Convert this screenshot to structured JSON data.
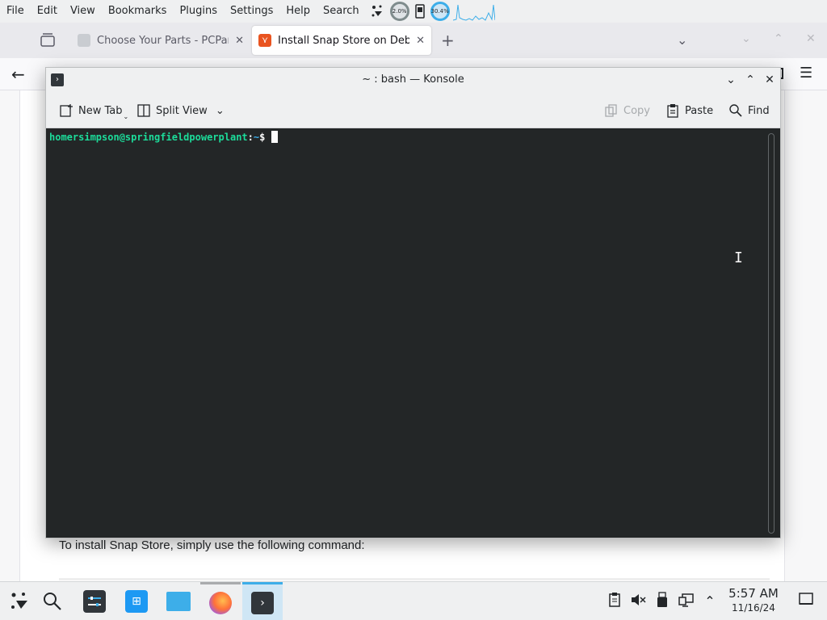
{
  "menubar": {
    "items": [
      "File",
      "Edit",
      "View",
      "Bookmarks",
      "Plugins",
      "Settings",
      "Help",
      "Search"
    ],
    "cpu_gauge": "2.0%",
    "net_gauge": "30.4%"
  },
  "browser": {
    "tabs": [
      {
        "title": "Choose Your Parts - PCPart",
        "icon": "pcpartpicker-favicon"
      },
      {
        "title": "Install Snap Store on Debia",
        "icon": "ubuntu-favicon",
        "active": true
      }
    ],
    "page_text": "To install Snap Store, simply use the following command:"
  },
  "konsole": {
    "title": "~ : bash — Konsole",
    "toolbar": {
      "new_tab": "New Tab",
      "split_view": "Split View",
      "copy": "Copy",
      "paste": "Paste",
      "find": "Find"
    },
    "prompt": {
      "user_host": "homersimpson@springfieldpowerplant",
      "sep": ":",
      "path": "~",
      "dollar": "$"
    }
  },
  "taskbar": {
    "apps": [
      "app-launcher",
      "search",
      "system-settings",
      "discover",
      "file-manager",
      "firefox",
      "konsole"
    ],
    "clock_time": "5:57 AM",
    "clock_date": "11/16/24"
  },
  "colors": {
    "accent": "#3daee9",
    "terminal_bg": "#232627",
    "prompt_user": "#1cdc9a",
    "prompt_path": "#3daee9"
  }
}
